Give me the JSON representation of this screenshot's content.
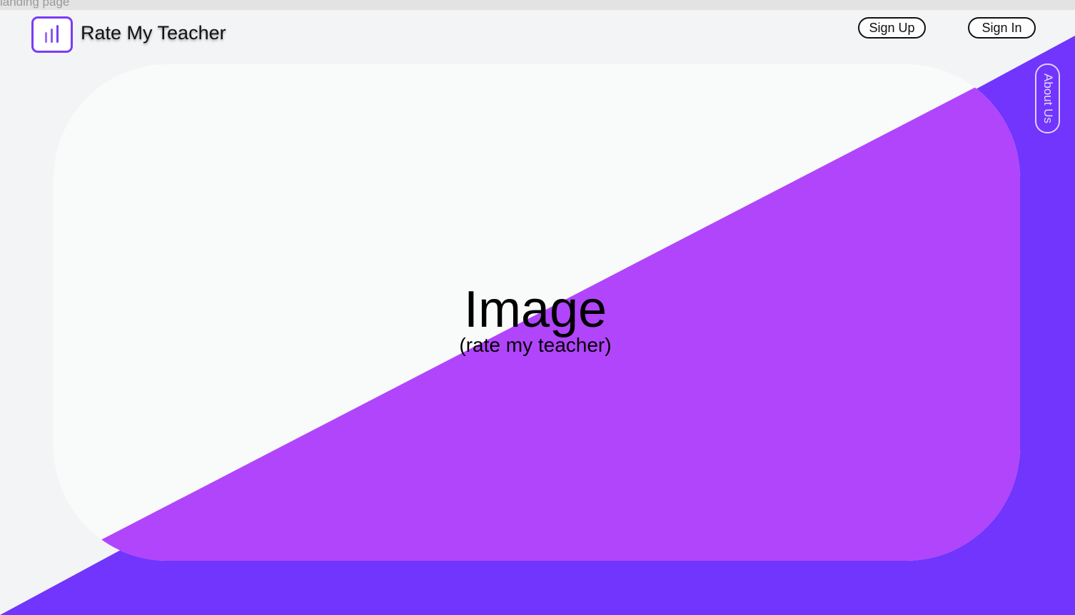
{
  "frame": {
    "label": "landing page"
  },
  "header": {
    "brand": {
      "icon": "bar-chart-icon",
      "title": "Rate My Teacher"
    },
    "sign_up_label": "Sign Up",
    "sign_in_label": "Sign In"
  },
  "side": {
    "about_label": "About Us"
  },
  "hero": {
    "main_text": "Image",
    "sub_text": "(rate my teacher)"
  },
  "colors": {
    "background": "#f3f4f6",
    "card": "#f9fafa",
    "accent_purple": "#7135fd",
    "card_purple": "#b145fb",
    "icon_border": "#7a3cf4"
  }
}
